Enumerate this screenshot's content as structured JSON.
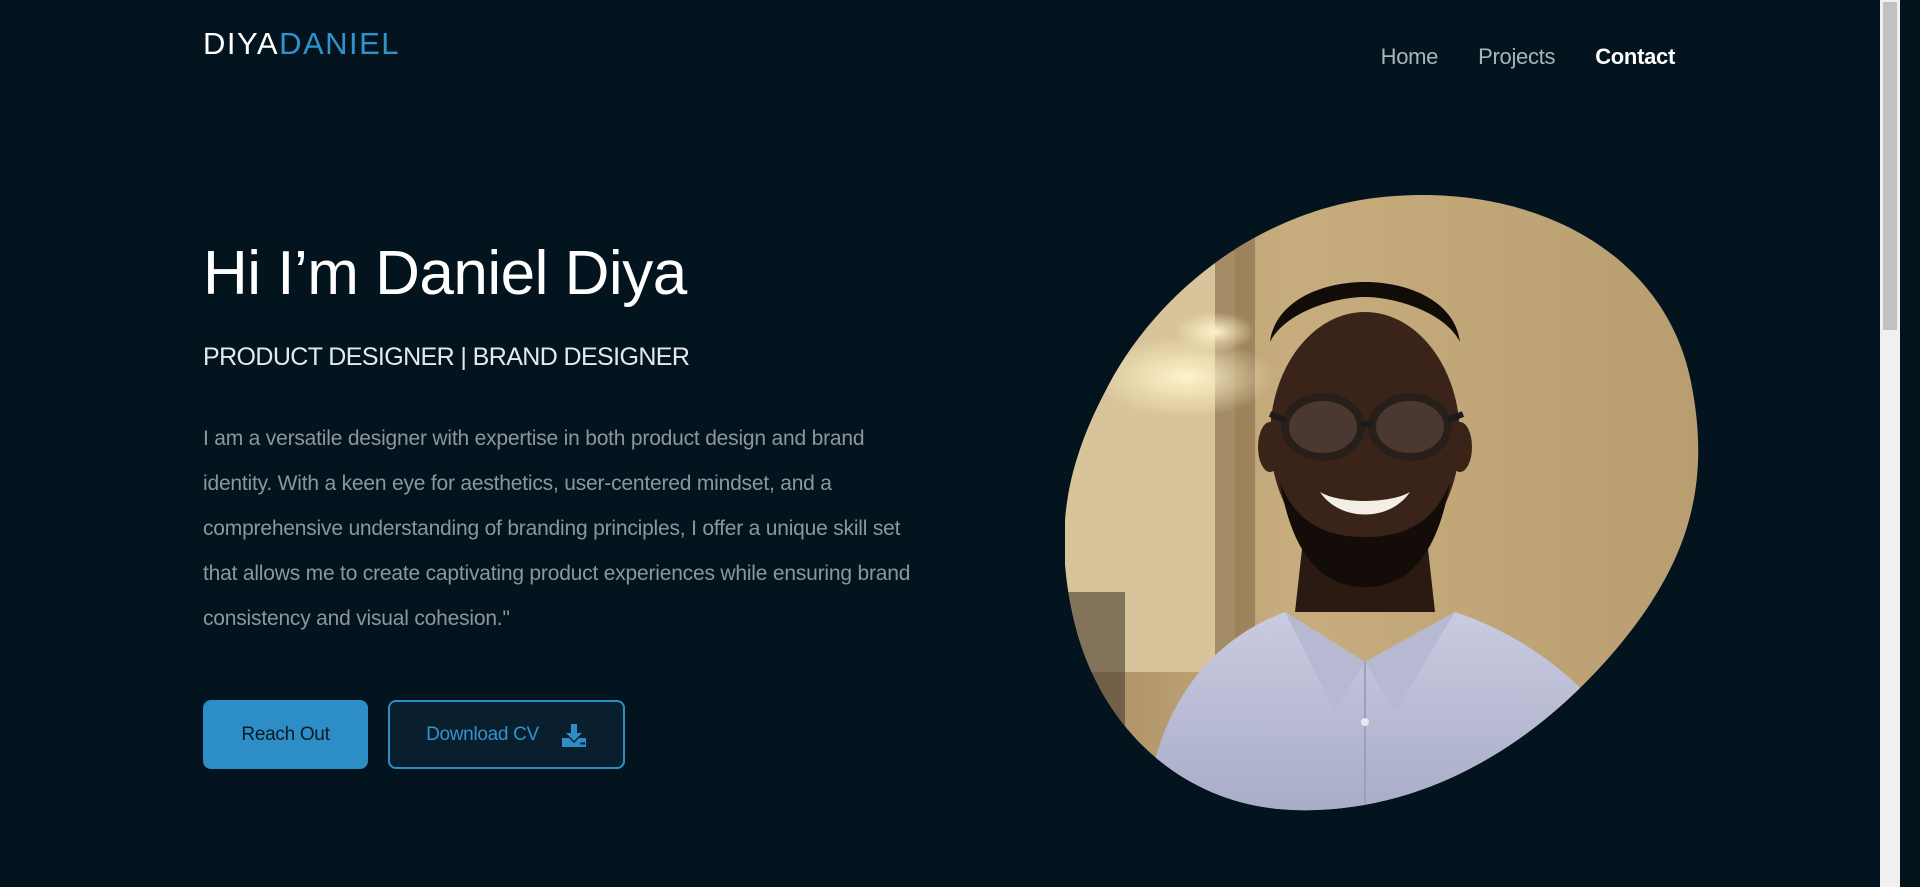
{
  "header": {
    "logo_first": "DIYA",
    "logo_last": "DANIEL",
    "nav": [
      {
        "label": "Home",
        "active": false
      },
      {
        "label": "Projects",
        "active": false
      },
      {
        "label": "Contact",
        "active": true
      }
    ]
  },
  "hero": {
    "title": "Hi I’m Daniel Diya",
    "subtitle": "PRODUCT DESIGNER | BRAND DESIGNER",
    "bio": "I am a versatile designer with expertise in both product design and brand identity. With a keen eye for aesthetics, user-centered mindset, and a comprehensive understanding of branding principles, I offer a unique skill set that allows me to create captivating product experiences while ensuring brand consistency and visual cohesion.\"",
    "reach_out_label": "Reach Out",
    "download_cv_label": "Download CV",
    "download_icon": "download-icon"
  },
  "colors": {
    "background": "#04141f",
    "accent": "#2d8ec7",
    "text_primary": "#ffffff",
    "text_muted": "#8d969c"
  }
}
